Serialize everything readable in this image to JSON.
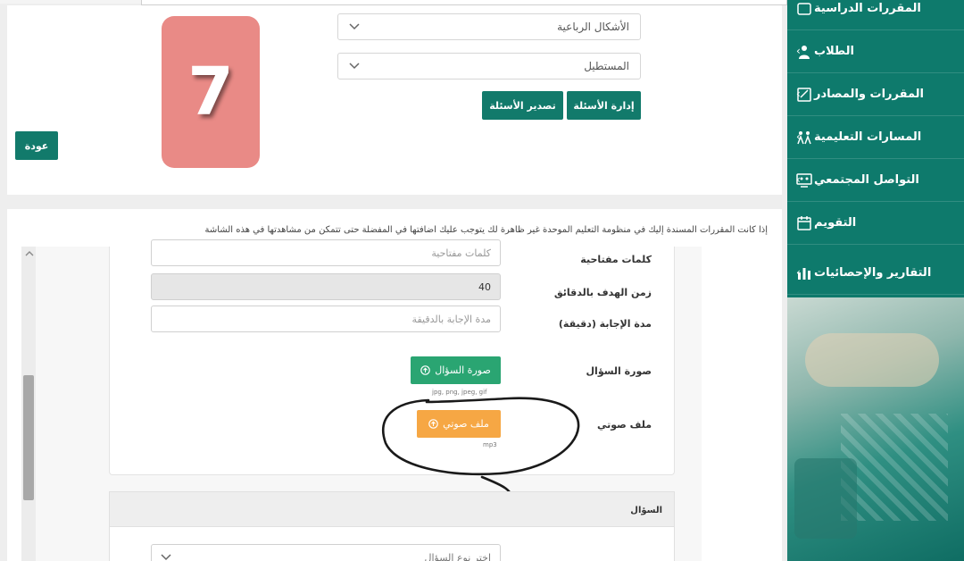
{
  "sidebar": {
    "items": [
      {
        "label": "المقررات الدراسية",
        "icon": "course-icon"
      },
      {
        "label": "الطلاب",
        "icon": "student-icon"
      },
      {
        "label": "المقررات والمصادر",
        "icon": "resources-icon"
      },
      {
        "label": "المسارات التعليمية",
        "icon": "learning-paths-icon"
      },
      {
        "label": "التواصل المجتمعي",
        "icon": "community-icon"
      },
      {
        "label": "التقويم",
        "icon": "calendar-icon"
      },
      {
        "label": "التقارير والإحصائيات",
        "icon": "reports-icon"
      }
    ],
    "color": "#0e7a6c"
  },
  "top": {
    "select_shapes": "الأشكال الرباعية",
    "select_rectangle": "المستطيل",
    "manage_questions": "إدارة الأسئلة",
    "export_questions": "تصدير الأسئلة",
    "back": "عودة",
    "badge_number": "7"
  },
  "notice": "إذا كانت المقررات المسندة إليك في منظومة التعليم الموحدة غير ظاهرة لك يتوجب عليك اضافتها في المفضلة حتى تتمكن من مشاهدتها في هذه الشاشة",
  "form": {
    "keywords_label": "كلمات مفتاحية",
    "keywords_placeholder": "كلمات مفتاحية",
    "target_time_label": "زمن الهدف بالدقائق",
    "target_time_value": "40",
    "answer_duration_label": "مدة الإجابة (دقيقة)",
    "answer_duration_placeholder": "مدة الإجابة بالدقيقة",
    "question_image_label": "صورة السؤال",
    "question_image_button": "صورة السؤال",
    "image_hint": "jpg, png, jpeg, gif",
    "audio_label": "ملف صوتي",
    "audio_button": "ملف صوتي",
    "audio_hint": "mp3",
    "question_section": "السؤال",
    "question_type_placeholder": "اختر نوع السؤال"
  },
  "colors": {
    "teal": "#127a6b",
    "green": "#2aa572",
    "orange": "#f6a744",
    "badge": "#e98a86"
  }
}
